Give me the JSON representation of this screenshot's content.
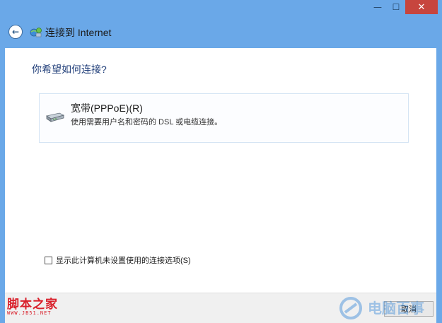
{
  "window": {
    "minimize_glyph": "—",
    "maximize_glyph": "☐",
    "close_glyph": "✕"
  },
  "header": {
    "title": "连接到 Internet",
    "back_icon": "back-arrow-icon",
    "network_icon": "network-globe-icon"
  },
  "main": {
    "question": "你希望如何连接?",
    "options": [
      {
        "title": "宽带(PPPoE)(R)",
        "description": "使用需要用户名和密码的 DSL 或电缆连接。",
        "icon": "modem-icon"
      }
    ],
    "checkbox": {
      "label": "显示此计算机未设置使用的连接选项(S)",
      "checked": false
    }
  },
  "footer": {
    "cancel_label": "取消"
  },
  "watermarks": {
    "left_cn": "脚本之家",
    "left_url": "WWW.JB51.NET",
    "right_text": "电脑百事"
  },
  "colors": {
    "frame": "#6aa8e8",
    "close_button": "#c7453e",
    "question_text": "#1f3d78",
    "watermark_red": "#d9202b"
  }
}
